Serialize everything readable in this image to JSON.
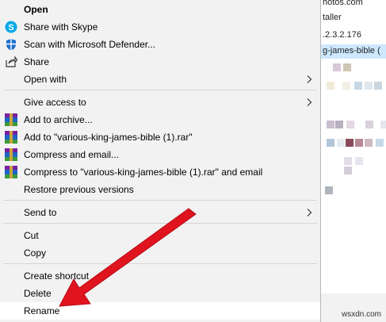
{
  "background": {
    "lines": [
      "hotos.com",
      "taller",
      ".2.3.2.176",
      "g-james-bible ("
    ],
    "watermark": "wsxdn.com"
  },
  "menu": {
    "items": [
      {
        "label": "Open",
        "icon": "none",
        "bold": true
      },
      {
        "label": "Share with Skype",
        "icon": "skype-icon"
      },
      {
        "label": "Scan with Microsoft Defender...",
        "icon": "defender-shield-icon"
      },
      {
        "label": "Share",
        "icon": "share-icon"
      },
      {
        "label": "Open with",
        "icon": "none",
        "submenu": true
      },
      {
        "label": "Give access to",
        "icon": "none",
        "submenu": true
      },
      {
        "label": "Add to archive...",
        "icon": "winrar-icon"
      },
      {
        "label": "Add to \"various-king-james-bible (1).rar\"",
        "icon": "winrar-icon"
      },
      {
        "label": "Compress and email...",
        "icon": "winrar-icon"
      },
      {
        "label": "Compress to \"various-king-james-bible (1).rar\" and email",
        "icon": "winrar-icon"
      },
      {
        "label": "Restore previous versions",
        "icon": "none"
      },
      {
        "label": "Send to",
        "icon": "none",
        "submenu": true
      },
      {
        "label": "Cut",
        "icon": "none"
      },
      {
        "label": "Copy",
        "icon": "none"
      },
      {
        "label": "Create shortcut",
        "icon": "none"
      },
      {
        "label": "Delete",
        "icon": "none"
      },
      {
        "label": "Rename",
        "icon": "none",
        "highlighted": true
      }
    ]
  },
  "colors": {
    "menu_bg": "#f2f2f2",
    "highlight": "#ffffff",
    "arrow": "#e0141e",
    "selection": "#cde8ff"
  }
}
